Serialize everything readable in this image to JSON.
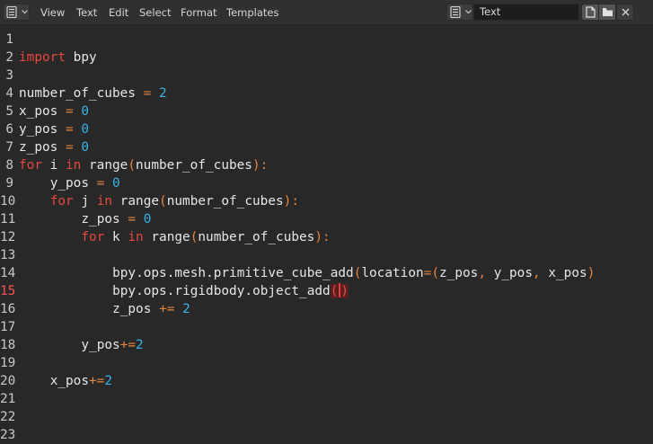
{
  "header": {
    "editor_type_icon": "text-editor-icon",
    "menus": [
      "View",
      "Text",
      "Edit",
      "Select",
      "Format",
      "Templates"
    ],
    "text_block_name": "Text",
    "browse_icon": "text-document-icon",
    "buttons": [
      "new-text-icon",
      "open-folder-icon",
      "close-icon"
    ]
  },
  "editor": {
    "current_line": 15,
    "line_numbers": [
      "1",
      "2",
      "3",
      "4",
      "5",
      "6",
      "7",
      "8",
      "9",
      "10",
      "11",
      "12",
      "13",
      "14",
      "15",
      "16",
      "17",
      "18",
      "19",
      "20",
      "21",
      "22",
      "23"
    ],
    "colors": {
      "keyword": "#e8473d",
      "number": "#38b4e8",
      "operator": "#e8853d",
      "text": "#e6e6e6",
      "current_line_number": "#ff5050"
    },
    "lines": [
      "",
      "import bpy",
      "",
      "number_of_cubes = 2",
      "x_pos = 0",
      "y_pos = 0",
      "z_pos = 0",
      "for i in range(number_of_cubes):",
      "    y_pos = 0",
      "    for j in range(number_of_cubes):",
      "        z_pos = 0",
      "        for k in range(number_of_cubes):",
      "",
      "            bpy.ops.mesh.primitive_cube_add(location=(z_pos, y_pos, x_pos)",
      "            bpy.ops.rigidbody.object_add()",
      "            z_pos += 2",
      "",
      "        y_pos+=2",
      "",
      "    x_pos+=2",
      "",
      "",
      ""
    ]
  }
}
